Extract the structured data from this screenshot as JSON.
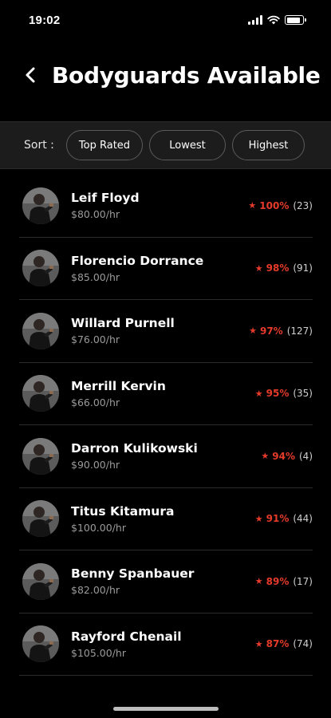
{
  "status_bar": {
    "time": "19:02"
  },
  "header": {
    "title": "Bodyguards Available"
  },
  "sort": {
    "label": "Sort :",
    "options": [
      "Top Rated",
      "Lowest",
      "Highest"
    ]
  },
  "bodyguards": [
    {
      "name": "Leif Floyd",
      "rate": "$80.00/hr",
      "rating": "100%",
      "reviews": "(23)"
    },
    {
      "name": "Florencio Dorrance",
      "rate": "$85.00/hr",
      "rating": "98%",
      "reviews": "(91)"
    },
    {
      "name": "Willard Purnell",
      "rate": "$76.00/hr",
      "rating": "97%",
      "reviews": "(127)"
    },
    {
      "name": "Merrill Kervin",
      "rate": "$66.00/hr",
      "rating": "95%",
      "reviews": "(35)"
    },
    {
      "name": "Darron Kulikowski",
      "rate": "$90.00/hr",
      "rating": "94%",
      "reviews": "(4)"
    },
    {
      "name": "Titus Kitamura",
      "rate": "$100.00/hr",
      "rating": "91%",
      "reviews": "(44)"
    },
    {
      "name": "Benny Spanbauer",
      "rate": "$82.00/hr",
      "rating": "89%",
      "reviews": "(17)"
    },
    {
      "name": "Rayford Chenail",
      "rate": "$105.00/hr",
      "rating": "87%",
      "reviews": "(74)"
    }
  ],
  "icons": {
    "back": "chevron-left-icon",
    "star": "star-icon",
    "signal": "cellular-signal-icon",
    "wifi": "wifi-icon",
    "battery": "battery-icon"
  },
  "colors": {
    "background": "#000000",
    "sort_bar": "#1c1c1c",
    "accent": "#e63a2b",
    "secondary_text": "#9a9a9a"
  },
  "battery_level": 0.85
}
